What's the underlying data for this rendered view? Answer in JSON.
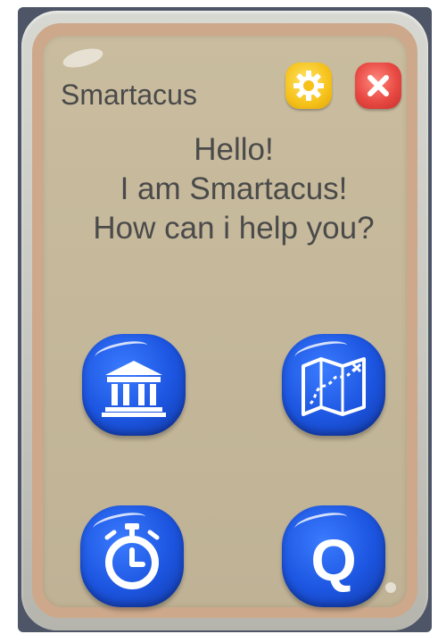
{
  "app": {
    "title": "Smartacus"
  },
  "greeting": {
    "lines": [
      "Hello!",
      "I am Smartacus!",
      "How can i help you?"
    ]
  },
  "header_buttons": {
    "settings_icon": "gear-icon",
    "close_icon": "close-icon"
  },
  "menu": {
    "items": [
      {
        "icon": "museum-icon"
      },
      {
        "icon": "map-icon"
      },
      {
        "icon": "stopwatch-icon"
      },
      {
        "icon": "quiz-icon",
        "glyph": "Q"
      }
    ]
  },
  "colors": {
    "panel": "#c9bc9f",
    "frame_tan": "#cda88b",
    "button_blue": "#1c55e0",
    "gear_yellow": "#f6c21a",
    "close_red": "#e84a43",
    "text": "#4a4a4a"
  }
}
